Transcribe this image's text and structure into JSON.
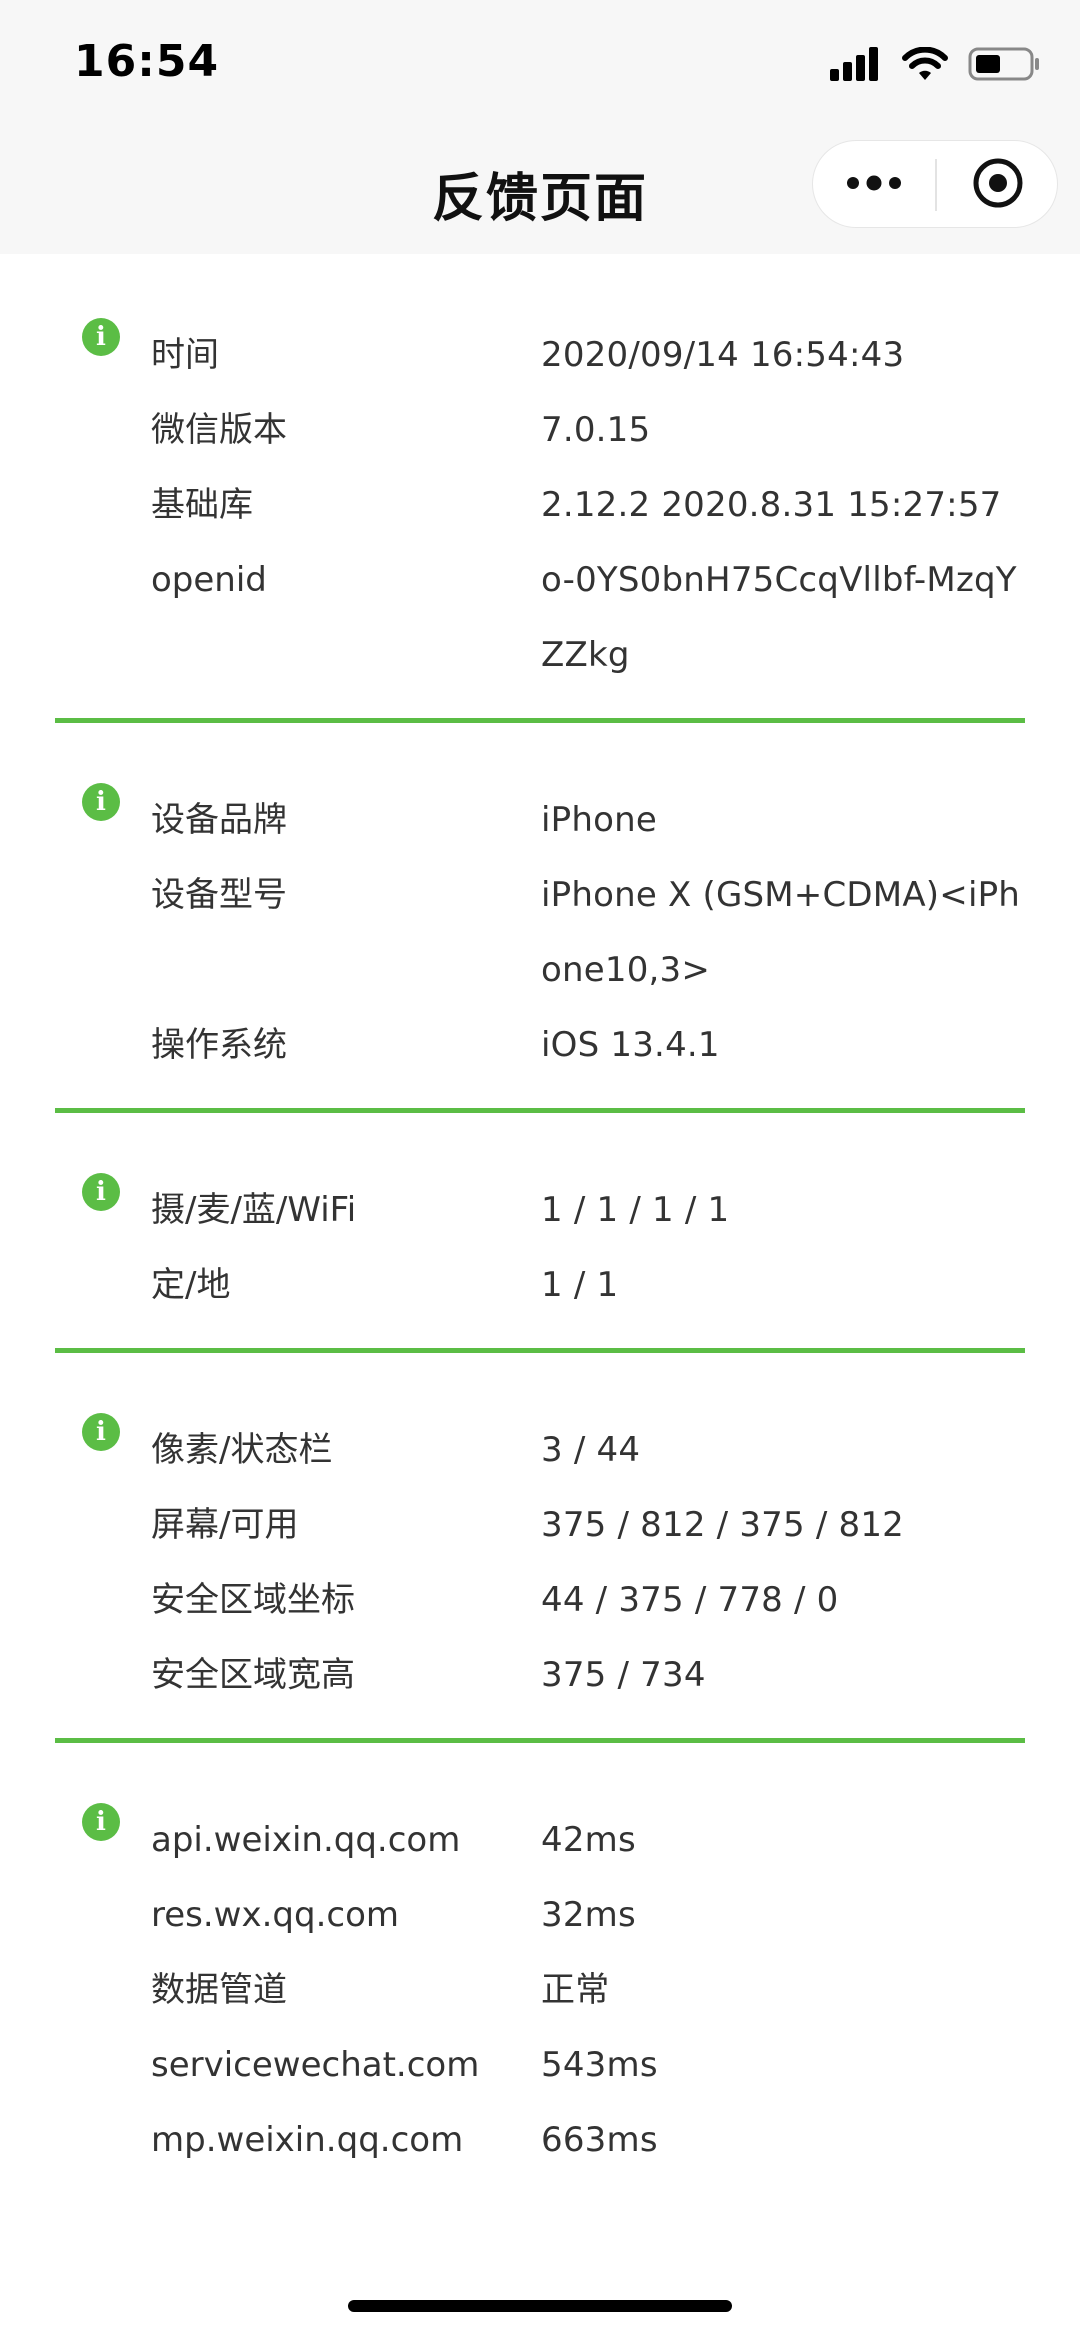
{
  "status_bar": {
    "time": "16:54",
    "icons": [
      "signal-icon",
      "wifi-icon",
      "battery-icon"
    ]
  },
  "nav": {
    "title": "反馈页面",
    "capsule": [
      "more-icon",
      "close-target-icon"
    ]
  },
  "colors": {
    "accent": "#5bbd45",
    "text": "#333333",
    "nav_bg": "#f7f7f7"
  },
  "sections": [
    {
      "icon": "info-icon",
      "rows": [
        {
          "label": "时间",
          "value": "2020/09/14 16:54:43"
        },
        {
          "label": "微信版本",
          "value": "7.0.15"
        },
        {
          "label": "基础库",
          "value": "2.12.2 2020.8.31 15:27:57"
        },
        {
          "label": "openid",
          "value": "o-0YS0bnH75CcqVllbf-MzqYZZkg"
        }
      ]
    },
    {
      "icon": "info-icon",
      "rows": [
        {
          "label": "设备品牌",
          "value": "iPhone"
        },
        {
          "label": "设备型号",
          "value": "iPhone X (GSM+CDMA)<iPhone10,3>"
        },
        {
          "label": "操作系统",
          "value": "iOS 13.4.1"
        }
      ]
    },
    {
      "icon": "info-icon",
      "rows": [
        {
          "label": "摄/麦/蓝/WiFi",
          "value": "1 / 1 / 1 / 1"
        },
        {
          "label": "定/地",
          "value": "1 / 1"
        }
      ]
    },
    {
      "icon": "info-icon",
      "rows": [
        {
          "label": "像素/状态栏",
          "value": "3 / 44"
        },
        {
          "label": "屏幕/可用",
          "value": "375 / 812 / 375 / 812"
        },
        {
          "label": "安全区域坐标",
          "value": "44 / 375 / 778 / 0"
        },
        {
          "label": "安全区域宽高",
          "value": "375 / 734"
        }
      ]
    },
    {
      "icon": "info-icon",
      "rows": [
        {
          "label": "api.weixin.qq.com",
          "value": "42ms"
        },
        {
          "label": "res.wx.qq.com",
          "value": "32ms"
        },
        {
          "label": "数据管道",
          "value": "正常"
        },
        {
          "label": "servicewechat.com",
          "value": "543ms"
        },
        {
          "label": "mp.weixin.qq.com",
          "value": "663ms"
        }
      ]
    }
  ]
}
